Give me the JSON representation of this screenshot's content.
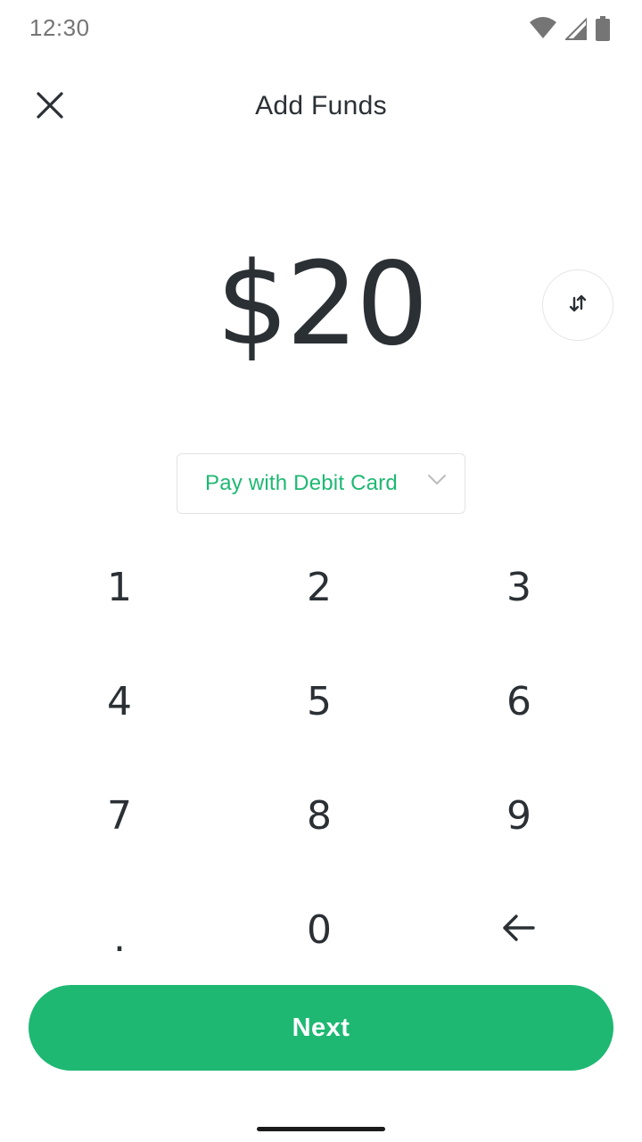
{
  "status_bar": {
    "time": "12:30",
    "icons": [
      "wifi-icon",
      "signal-icon",
      "battery-icon"
    ]
  },
  "header": {
    "close_icon": "close-icon",
    "title": "Add Funds"
  },
  "amount": {
    "value": "$20",
    "toggle_icon": "swap-arrows-icon"
  },
  "pay_method": {
    "label": "Pay with Debit Card",
    "chevron_icon": "chevron-down-icon"
  },
  "keypad": {
    "rows": [
      [
        "1",
        "2",
        "3"
      ],
      [
        "4",
        "5",
        "6"
      ],
      [
        "7",
        "8",
        "9"
      ],
      [
        ".",
        "0",
        "backspace-icon"
      ]
    ]
  },
  "next_button": {
    "label": "Next"
  },
  "colors": {
    "accent": "#1eb873",
    "text": "#2b3035",
    "muted": "#757575",
    "border": "#e3e3e3"
  }
}
